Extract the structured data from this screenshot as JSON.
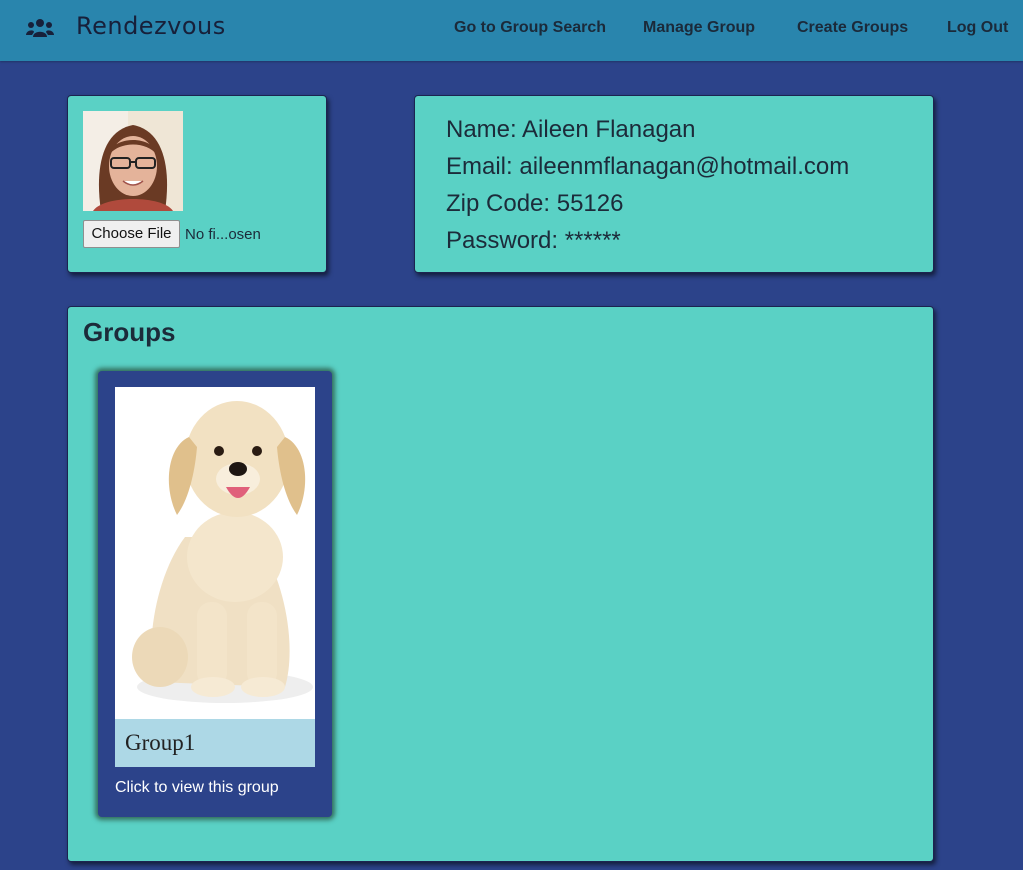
{
  "app": {
    "brand": "Rendezvous",
    "brand_icon": "users-icon"
  },
  "nav": {
    "items": [
      {
        "label": "Go to Group Search"
      },
      {
        "label": "Manage Group"
      },
      {
        "label": "Create Groups"
      },
      {
        "label": "Log Out"
      }
    ]
  },
  "profile": {
    "avatar_icon": "user-photo",
    "file_button_label": "Choose File",
    "file_status": "No fi...osen"
  },
  "info": {
    "name": "Name: Aileen Flanagan",
    "email": "Email: aileenmflanagan@hotmail.com",
    "zip": "Zip Code: 55126",
    "password": "Password: ******"
  },
  "groups": {
    "title": "Groups",
    "items": [
      {
        "name": "Group1",
        "caption": "Click to view this group",
        "image": "puppy-photo"
      }
    ]
  },
  "colors": {
    "page_bg": "#2c438a",
    "navbar_bg": "#2985ad",
    "card_bg": "#5ad1c5",
    "group_band": "#add8e6"
  }
}
